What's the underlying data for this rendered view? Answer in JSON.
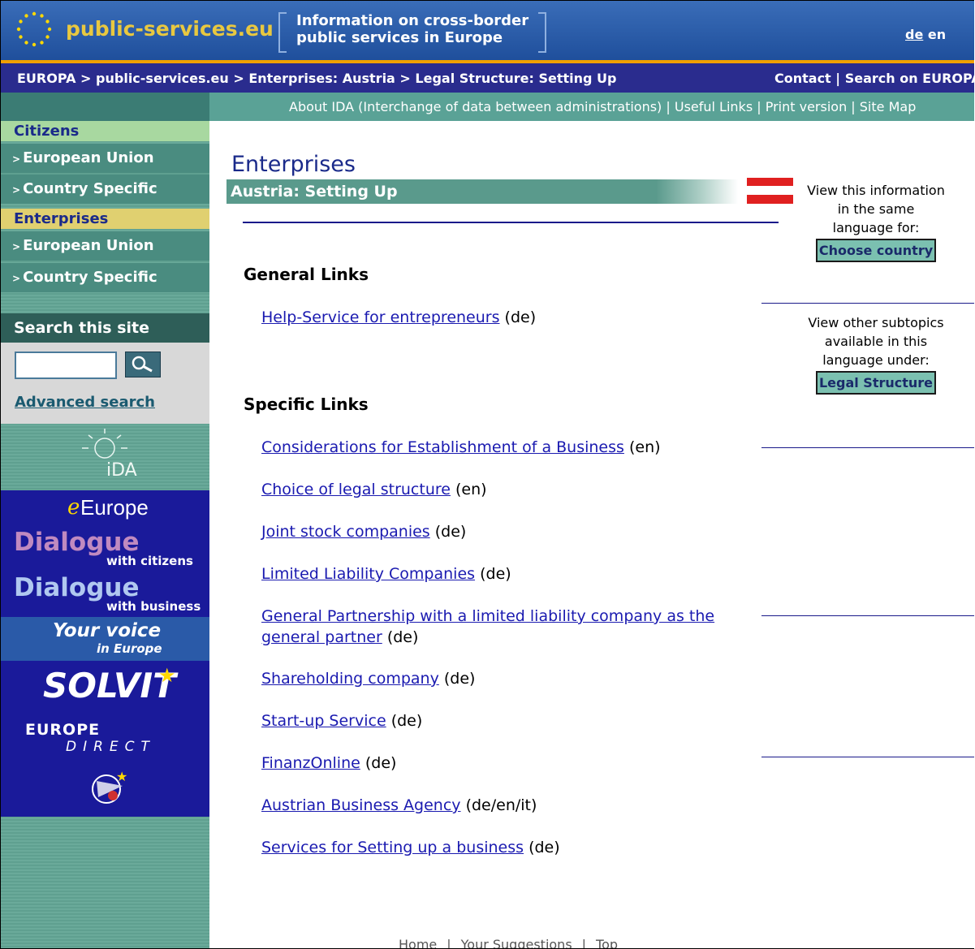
{
  "header": {
    "brand": "public-services.eu",
    "tagline_line1": "Information on cross-border",
    "tagline_line2": "public services in Europe",
    "lang_de": "de",
    "lang_en": "en"
  },
  "breadcrumb": {
    "path": "EUROPA > public-services.eu > Enterprises: Austria > Legal Structure: Setting Up",
    "right": "Contact | Search on EUROPA"
  },
  "subnav": {
    "links": "About IDA (Interchange of data between administrations) | Useful Links | Print version | Site Map"
  },
  "sidebar": {
    "citizens_title": "Citizens",
    "citizens_items": [
      "European Union",
      "Country Specific"
    ],
    "enterprises_title": "Enterprises",
    "enterprises_items": [
      "European Union",
      "Country Specific"
    ],
    "search_title": "Search this site",
    "search_value": "",
    "advanced_search": "Advanced search",
    "banners": {
      "ida": "iDA",
      "eeurope_e": "e",
      "eeurope": "Europe",
      "dialogue1": "Dialogue",
      "dialogue1_sub": "with citizens",
      "dialogue2": "Dialogue",
      "dialogue2_sub": "with business",
      "voice1": "Your voice",
      "voice2": "in Europe",
      "solvit": "SOLVIT",
      "europe_direct1": "EUROPE",
      "europe_direct2": "DIRECT"
    }
  },
  "main": {
    "title": "Enterprises",
    "subtitle": "Austria: Setting Up",
    "general_heading": "General Links",
    "general_links": [
      {
        "text": "Help-Service for entrepreneurs",
        "lang": "(de)"
      }
    ],
    "specific_heading": "Specific Links",
    "specific_links": [
      {
        "text": "Considerations for Establishment of a Business",
        "lang": "(en)"
      },
      {
        "text": "Choice of legal structure",
        "lang": "(en)"
      },
      {
        "text": "Joint stock companies",
        "lang": "(de)"
      },
      {
        "text": "Limited Liability Companies",
        "lang": "(de)"
      },
      {
        "text": "General Partnership with a limited liability company as the",
        "text2": "general partner",
        "lang": "(de)"
      },
      {
        "text": "Shareholding company",
        "lang": "(de)"
      },
      {
        "text": "Start-up Service",
        "lang": "(de)"
      },
      {
        "text": "FinanzOnline",
        "lang": "(de)"
      },
      {
        "text": "Austrian Business Agency",
        "lang": "(de/en/it)"
      },
      {
        "text": "Services for Setting up a business",
        "lang": "(de)"
      }
    ]
  },
  "right_panel": {
    "note1_line1": "View this information",
    "note1_line2": "in the same",
    "note1_line3": "language for:",
    "choose_country": "Choose country",
    "note2_line1": "View other subtopics",
    "note2_line2": "available in this",
    "note2_line3": "language under:",
    "legal_structure": "Legal Structure"
  },
  "footer": {
    "home": "Home",
    "suggestions": "Your Suggestions",
    "top": "Top"
  },
  "colors": {
    "header_blue": "#1f4f9c",
    "crumb_navy": "#2a2c8e",
    "teal": "#5a9a8c",
    "link_blue": "#1a1ab0"
  }
}
